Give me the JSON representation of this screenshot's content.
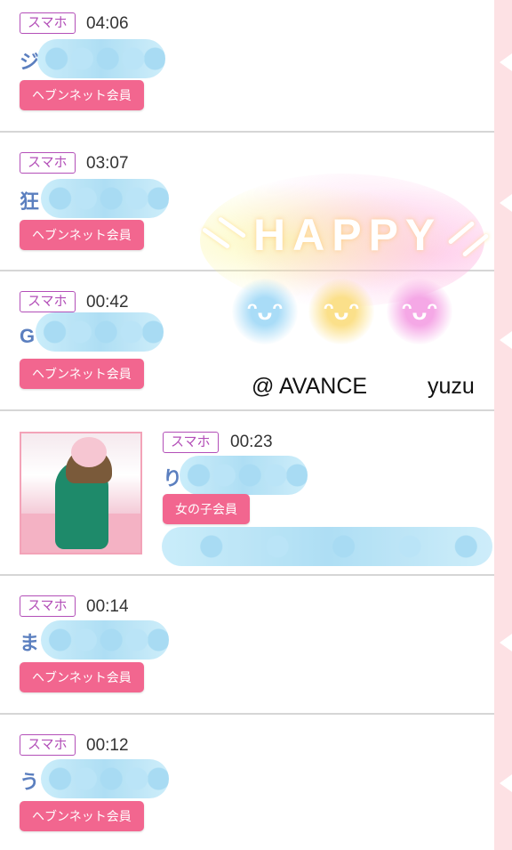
{
  "theme": {
    "badge_color": "#b34fb8",
    "button_color": "#f2668f",
    "name_color": "#5b7fbf",
    "strip_color": "#fde1e4"
  },
  "rows": [
    {
      "device": "スマホ",
      "time": "04:06",
      "name_initial": "ジ",
      "member_label": "ヘブンネット会員"
    },
    {
      "device": "スマホ",
      "time": "03:07",
      "name_initial": "狂",
      "member_label": "ヘブンネット会員"
    },
    {
      "device": "スマホ",
      "time": "00:42",
      "name_initial": "G",
      "member_label": "ヘブンネット会員"
    },
    {
      "device": "スマホ",
      "time": "00:23",
      "name_initial": "り",
      "member_label": "女の子会員",
      "has_photo": true
    },
    {
      "device": "スマホ",
      "time": "00:14",
      "name_initial": "ま",
      "member_label": "ヘブンネット会員"
    },
    {
      "device": "スマホ",
      "time": "00:12",
      "name_initial": "う",
      "member_label": "ヘブンネット会員"
    }
  ],
  "stamp": {
    "headline": "HAPPY",
    "faces": [
      "ᵔᴗᵔ",
      "ᵔᴗᵔ",
      "ᵔᴗᵔ"
    ],
    "face_colors": [
      "#a9dcf7",
      "#fbe08a",
      "#f5a8e6"
    ]
  },
  "watermark": {
    "shop": "@ AVANCE",
    "user": "yuzu"
  }
}
